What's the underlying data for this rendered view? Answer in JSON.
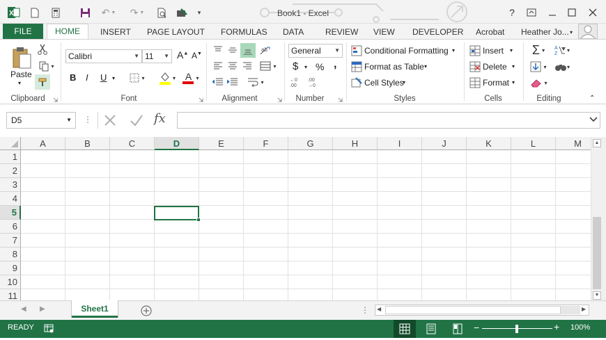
{
  "window": {
    "title": "Book1 - Excel",
    "help": "?",
    "buttons": [
      "restore-ribbon",
      "minimize",
      "maximize",
      "close"
    ]
  },
  "qat": [
    "excel-logo",
    "new-file",
    "calculator",
    "save",
    "undo",
    "redo",
    "print-preview",
    "quick-tool",
    "customize"
  ],
  "tabs": {
    "file": "FILE",
    "home": "HOME",
    "items": [
      "INSERT",
      "PAGE LAYOUT",
      "FORMULAS",
      "DATA",
      "REVIEW",
      "VIEW",
      "DEVELOPER",
      "Acrobat"
    ],
    "user": "Heather Jo..."
  },
  "ribbon": {
    "clipboard": {
      "label": "Clipboard",
      "paste": "Paste"
    },
    "font": {
      "label": "Font",
      "name": "Calibri",
      "size": "11",
      "bold": "B",
      "italic": "I",
      "underline": "U",
      "grow": "A",
      "shrink": "A",
      "font_color": "A"
    },
    "alignment": {
      "label": "Alignment"
    },
    "number": {
      "label": "Number",
      "format": "General",
      "currency": "$",
      "percent": "%",
      "comma": ","
    },
    "styles": {
      "label": "Styles",
      "conditional": "Conditional Formatting",
      "table": "Format as Table",
      "cell": "Cell Styles"
    },
    "cells": {
      "label": "Cells",
      "insert": "Insert",
      "delete": "Delete",
      "format": "Format"
    },
    "editing": {
      "label": "Editing"
    }
  },
  "formula_bar": {
    "name_box": "D5",
    "fx": "fx",
    "formula": ""
  },
  "grid": {
    "columns": [
      "A",
      "B",
      "C",
      "D",
      "E",
      "F",
      "G",
      "H",
      "I",
      "J",
      "K",
      "L",
      "M"
    ],
    "rows": [
      "1",
      "2",
      "3",
      "4",
      "5",
      "6",
      "7",
      "8",
      "9",
      "10",
      "11"
    ],
    "active_cell": "D5",
    "active_column": "D",
    "active_row": "5"
  },
  "sheets": {
    "tabs": [
      "Sheet1"
    ],
    "active": "Sheet1"
  },
  "status": {
    "ready": "READY",
    "zoom": "100%"
  },
  "colors": {
    "accent": "#217346",
    "header_bg": "#f3f3f3",
    "gridline": "#e1e1e1"
  }
}
